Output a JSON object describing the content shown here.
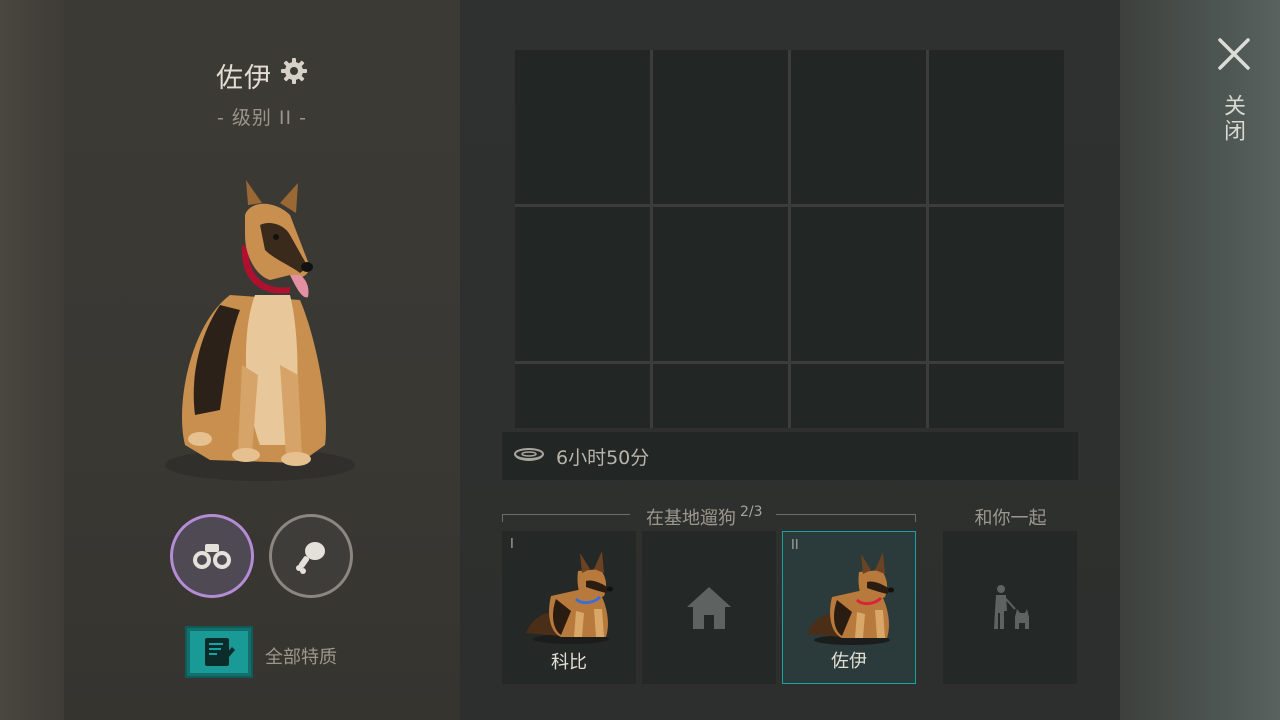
{
  "dog": {
    "name": "佐伊",
    "level": "- 级别 II -"
  },
  "actions": {
    "scout_icon": "binoculars-icon",
    "feed_icon": "meat-icon",
    "traits_label": "全部特质"
  },
  "inventory": {
    "slot_count": 12,
    "timer": "6小时50分"
  },
  "walk": {
    "title": "在基地遛狗",
    "count": "2/3",
    "together_title": "和你一起"
  },
  "cards": [
    {
      "level": "I",
      "name": "科比",
      "collar": "#3a6fd6"
    },
    {
      "level": "",
      "name": "",
      "icon": "home-icon"
    },
    {
      "level": "II",
      "name": "佐伊",
      "collar": "#d6243a"
    }
  ],
  "together_card": {
    "icon": "person-with-dog-icon"
  },
  "close": {
    "label": "关闭"
  },
  "colors": {
    "accent_teal": "#19a3a0",
    "scout_ring": "#b48cd6"
  }
}
